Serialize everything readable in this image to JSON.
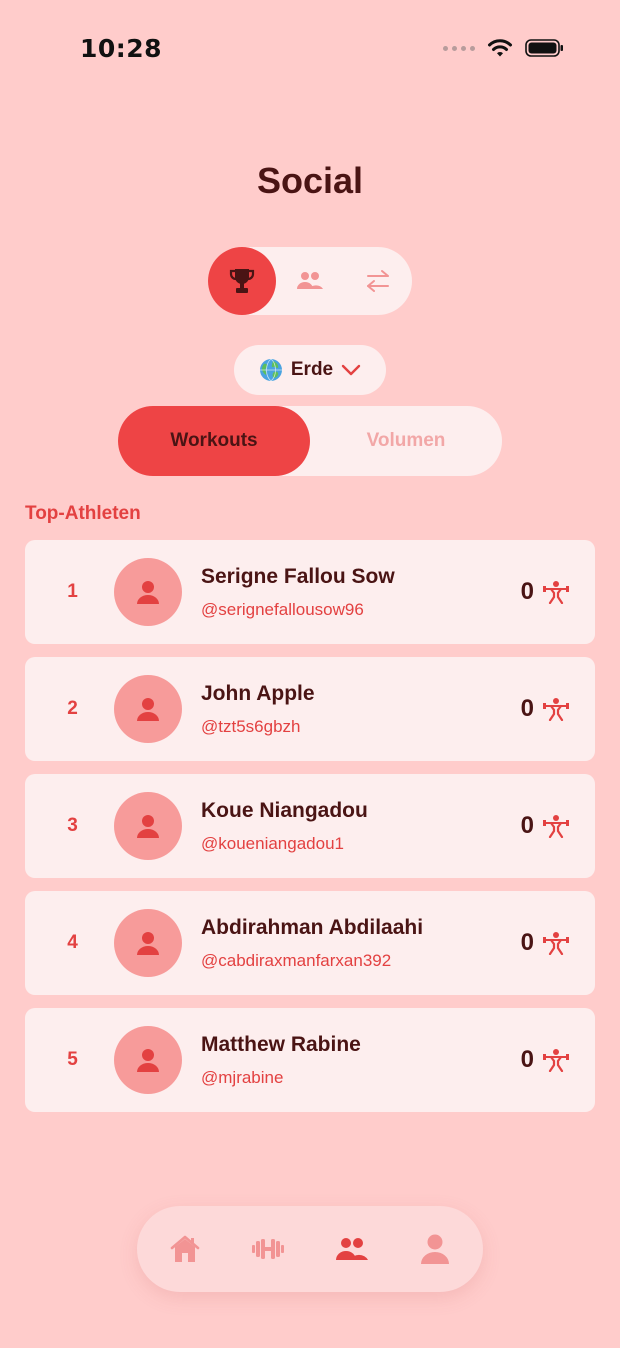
{
  "status_bar": {
    "time": "10:28"
  },
  "header": {
    "title": "Social"
  },
  "mode_switch": {
    "items": [
      {
        "icon": "trophy-icon",
        "active": true
      },
      {
        "icon": "friends-icon",
        "active": false
      },
      {
        "icon": "swap-icon",
        "active": false
      }
    ]
  },
  "region": {
    "label": "Erde",
    "icon": "globe-icon"
  },
  "segment": {
    "workouts": "Workouts",
    "volume": "Volumen",
    "selected": "Workouts"
  },
  "leaderboard": {
    "section_label": "Top-Athleten",
    "rows": [
      {
        "rank": "1",
        "name": "Serigne Fallou Sow",
        "handle": "@serignefallousow96",
        "score": "0"
      },
      {
        "rank": "2",
        "name": "John Apple",
        "handle": "@tzt5s6gbzh",
        "score": "0"
      },
      {
        "rank": "3",
        "name": "Koue Niangadou",
        "handle": "@koueniangadou1",
        "score": "0"
      },
      {
        "rank": "4",
        "name": "Abdirahman Abdilaahi",
        "handle": "@cabdiraxmanfarxan392",
        "score": "0"
      },
      {
        "rank": "5",
        "name": "Matthew Rabine",
        "handle": "@mjrabine",
        "score": "0"
      }
    ]
  },
  "tabbar": {
    "items": [
      {
        "icon": "home-icon",
        "active": false
      },
      {
        "icon": "dumbbell-icon",
        "active": false
      },
      {
        "icon": "social-icon",
        "active": true
      },
      {
        "icon": "profile-icon",
        "active": false
      }
    ]
  },
  "colors": {
    "background": "#ffcccb",
    "accent": "#ee4445",
    "card": "#fdeeee",
    "text_dark": "#4a1414",
    "text_accent": "#e34141"
  }
}
